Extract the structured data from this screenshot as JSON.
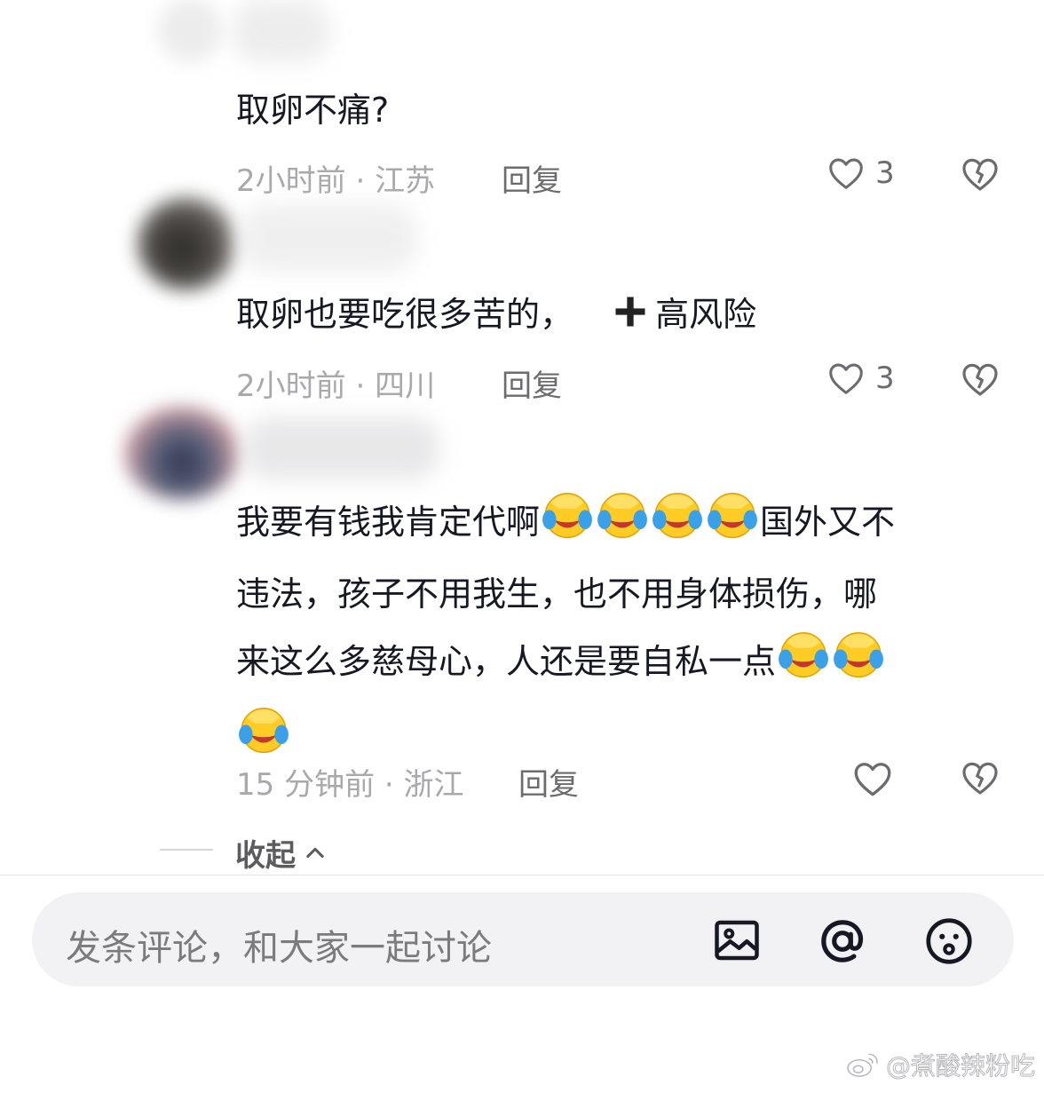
{
  "comments": [
    {
      "text": "取卵不痛?",
      "time": "2小时前",
      "location": "江苏",
      "reply": "回复",
      "likes": "3"
    },
    {
      "text": "取卵也要吃很多苦的，",
      "text_suffix": "高风险",
      "time": "2小时前",
      "location": "四川",
      "reply": "回复",
      "likes": "3"
    },
    {
      "line1": "我要有钱我肯定代啊",
      "line1_tail": "国外又不",
      "line2": "违法，孩子不用我生，也不用身体损伤，哪",
      "line3": "来这么多慈母心，人还是要自私一点",
      "emoji_name": "laughing-crying-emoji",
      "time": "15 分钟前",
      "location": "浙江",
      "reply": "回复"
    }
  ],
  "meta_separator": " · ",
  "collapse_label": "收起",
  "input": {
    "placeholder": "发条评论，和大家一起讨论"
  },
  "watermark": "@煮酸辣粉吃",
  "colors": {
    "text": "#161823",
    "meta": "#a8a8ad",
    "action": "#6b6b70",
    "input_bg": "#f2f2f4"
  }
}
